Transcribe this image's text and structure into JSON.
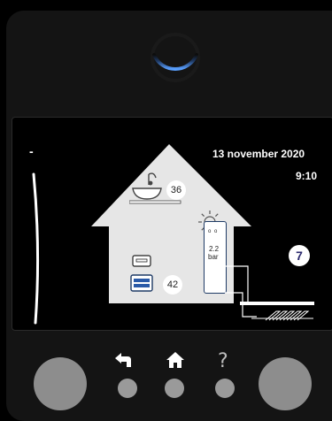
{
  "screen": {
    "date": "13 november 2020",
    "time": "9:10",
    "setpoint_marker": "-"
  },
  "house": {
    "tap_water_temp": "36",
    "heating_temp": "42",
    "pressure_value": "2.2",
    "pressure_unit": "bar",
    "boiler_dots": "o o"
  },
  "zone_badge": "7",
  "status_ring_color": "#4a90e2",
  "nav": {
    "back_icon": "back-arrow-icon",
    "home_icon": "home-icon",
    "help_label": "?"
  }
}
